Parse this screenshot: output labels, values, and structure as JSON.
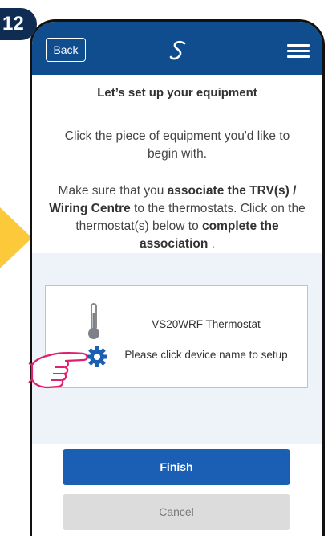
{
  "step_number": "12",
  "topbar": {
    "back_label": "Back",
    "logo_icon": "salus-logo-icon",
    "menu_icon": "hamburger-menu-icon"
  },
  "heading": "Let’s set up your equipment",
  "intro": "Click the piece of equipment you'd like to begin with.",
  "instruction": {
    "part1": "Make sure that you ",
    "bold1": "associate the TRV(s) / Wiring Centre",
    "part2": " to the thermostats. Click on the thermostat(s) below to ",
    "bold2": "complete the association",
    "part3": " ."
  },
  "device": {
    "name": "VS20WRF Thermostat",
    "hint": "Please click device name to setup",
    "icons": [
      "thermometer-icon",
      "gear-icon"
    ]
  },
  "buttons": {
    "finish": "Finish",
    "cancel": "Cancel"
  },
  "colors": {
    "topbar": "#0f4d8f",
    "primary_button": "#1b5fb5",
    "step_badge": "#0f2d52",
    "arrow": "#fcc93a",
    "hand": "#e0206e"
  }
}
